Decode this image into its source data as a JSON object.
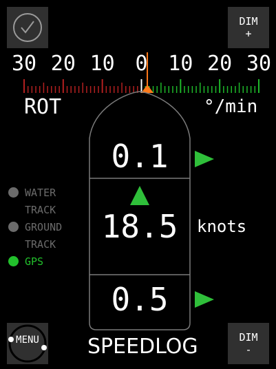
{
  "dim_up": {
    "line1": "DIM",
    "line2": "+"
  },
  "dim_down": {
    "line1": "DIM",
    "line2": "-"
  },
  "menu_label": "MENU",
  "scale": {
    "labels": [
      "30",
      "20",
      "10",
      "0",
      "10",
      "20",
      "30"
    ],
    "port_color": "#b32020",
    "starboard_color": "#1eb82a",
    "center_color": "#ffffff",
    "pointer_color": "#ff7a1a",
    "rate_value": 1.5
  },
  "rot": {
    "label": "ROT",
    "unit": "°/min",
    "value": "0.1"
  },
  "speed": {
    "value": "18.5",
    "unit": "knots"
  },
  "drift": {
    "value": "0.5"
  },
  "modes": [
    {
      "line1": "WATER",
      "line2": "TRACK",
      "active": false
    },
    {
      "line1": "GROUND",
      "line2": "TRACK",
      "active": false
    },
    {
      "line1": "GPS",
      "line2": "",
      "active": true
    }
  ],
  "title": "SPEEDLOG",
  "colors": {
    "arrow": "#2fbf3a",
    "active": "#22c02c",
    "inactive": "#6b6b6b",
    "button": "#303030"
  }
}
